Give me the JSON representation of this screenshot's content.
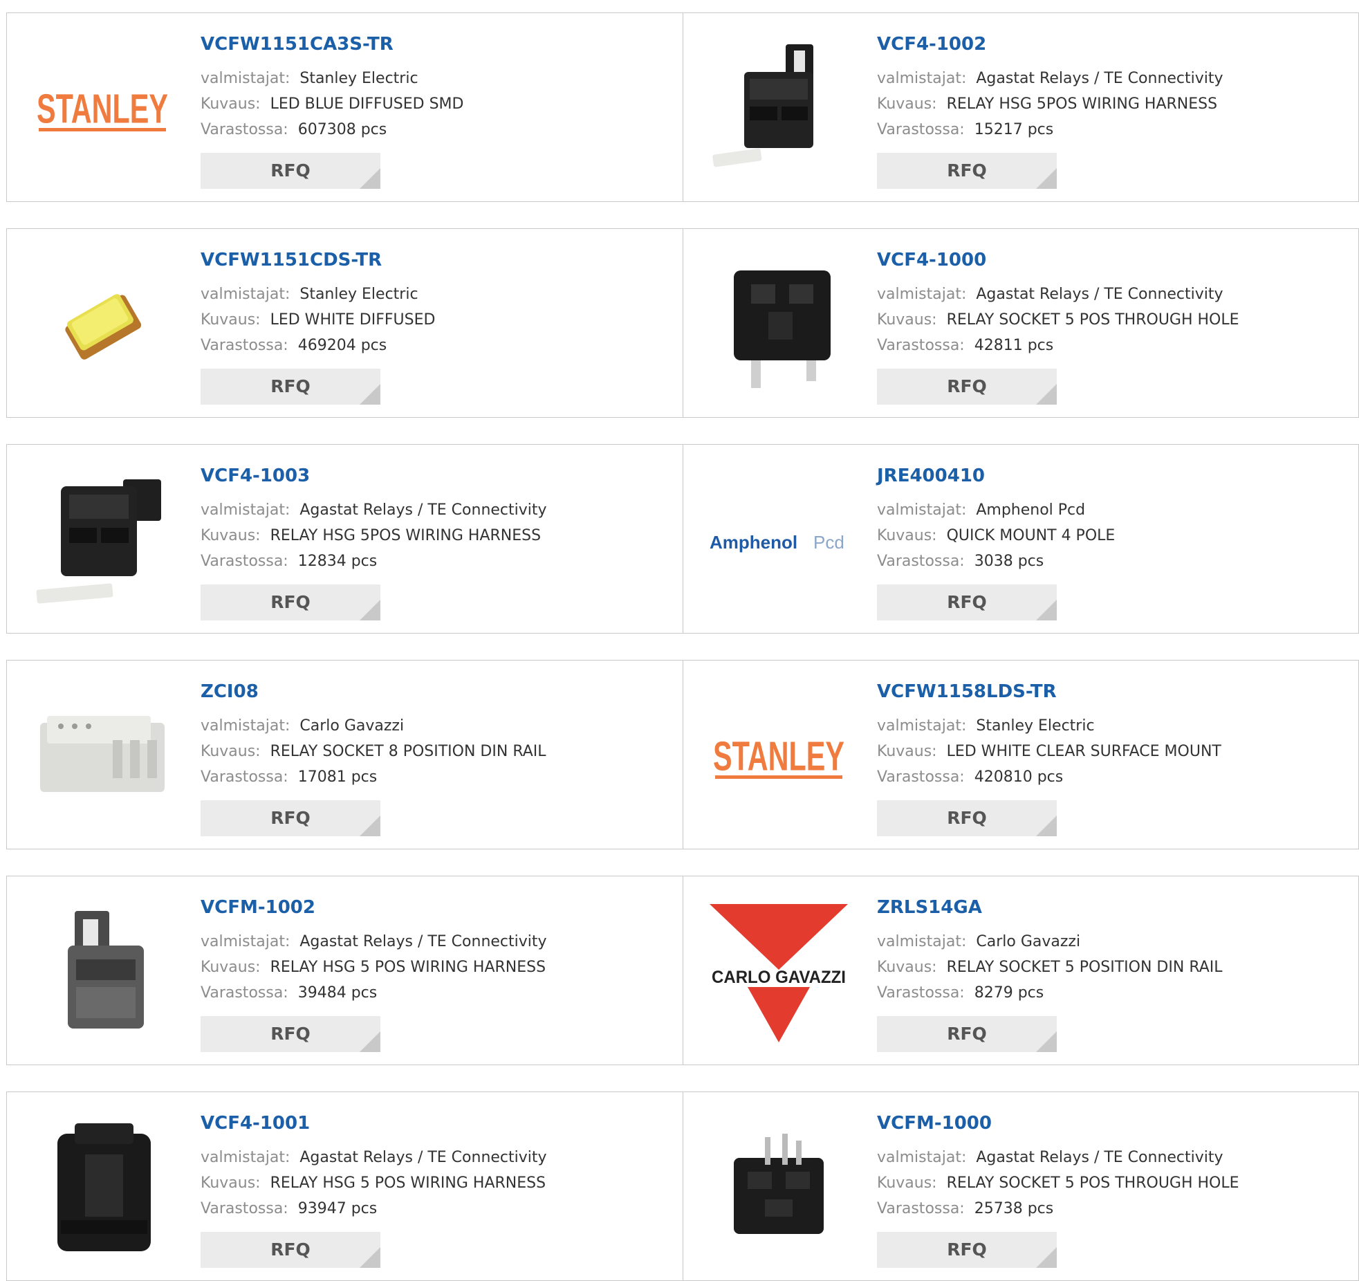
{
  "labels": {
    "manufacturer": "valmistajat:",
    "description": "Kuvaus:",
    "stock": "Varastossa:",
    "rfq": "RFQ"
  },
  "colors": {
    "link": "#1a5fa8",
    "rfq_bg": "#ebebeb",
    "stanley": "#f07b3f",
    "gavazzi": "#e33b2e",
    "amphenol": "#1f5aa6"
  },
  "products": [
    {
      "part": "VCFW1151CA3S-TR",
      "manufacturer": "Stanley Electric",
      "description": "LED BLUE DIFFUSED SMD",
      "stock": "607308 pcs",
      "image": "stanley-logo",
      "logo_text": "STANLEY"
    },
    {
      "part": "VCF4-1002",
      "manufacturer": "Agastat Relays / TE Connectivity",
      "description": "RELAY HSG 5POS WIRING HARNESS",
      "stock": "15217 pcs",
      "image": "relay-housing-clip"
    },
    {
      "part": "VCFW1151CDS-TR",
      "manufacturer": "Stanley Electric",
      "description": "LED WHITE DIFFUSED",
      "stock": "469204 pcs",
      "image": "smd-led-yellow"
    },
    {
      "part": "VCF4-1000",
      "manufacturer": "Agastat Relays / TE Connectivity",
      "description": "RELAY SOCKET 5 POS THROUGH HOLE",
      "stock": "42811 pcs",
      "image": "relay-socket-pins"
    },
    {
      "part": "VCF4-1003",
      "manufacturer": "Agastat Relays / TE Connectivity",
      "description": "RELAY HSG 5POS WIRING HARNESS",
      "stock": "12834 pcs",
      "image": "relay-housing-side"
    },
    {
      "part": "JRE400410",
      "manufacturer": "Amphenol Pcd",
      "description": "QUICK MOUNT 4 POLE",
      "stock": "3038 pcs",
      "image": "amphenol-logo",
      "logo_text": "Amphenol",
      "logo_text2": "Pcd"
    },
    {
      "part": "ZCI08",
      "manufacturer": "Carlo Gavazzi",
      "description": "RELAY SOCKET 8 POSITION DIN RAIL",
      "stock": "17081 pcs",
      "image": "din-socket-white"
    },
    {
      "part": "VCFW1158LDS-TR",
      "manufacturer": "Stanley Electric",
      "description": "LED WHITE CLEAR SURFACE MOUNT",
      "stock": "420810 pcs",
      "image": "stanley-logo",
      "logo_text": "STANLEY"
    },
    {
      "part": "VCFM-1002",
      "manufacturer": "Agastat Relays / TE Connectivity",
      "description": "RELAY HSG 5 POS WIRING HARNESS",
      "stock": "39484 pcs",
      "image": "relay-housing-grey"
    },
    {
      "part": "ZRLS14GA",
      "manufacturer": "Carlo Gavazzi",
      "description": "RELAY SOCKET 5 POSITION DIN RAIL",
      "stock": "8279 pcs",
      "image": "carlo-gavazzi-logo",
      "logo_text": "CARLO GAVAZZI"
    },
    {
      "part": "VCF4-1001",
      "manufacturer": "Agastat Relays / TE Connectivity",
      "description": "RELAY HSG 5 POS WIRING HARNESS",
      "stock": "93947 pcs",
      "image": "relay-housing-black"
    },
    {
      "part": "VCFM-1000",
      "manufacturer": "Agastat Relays / TE Connectivity",
      "description": "RELAY SOCKET 5 POS THROUGH HOLE",
      "stock": "25738 pcs",
      "image": "relay-socket-top"
    }
  ]
}
